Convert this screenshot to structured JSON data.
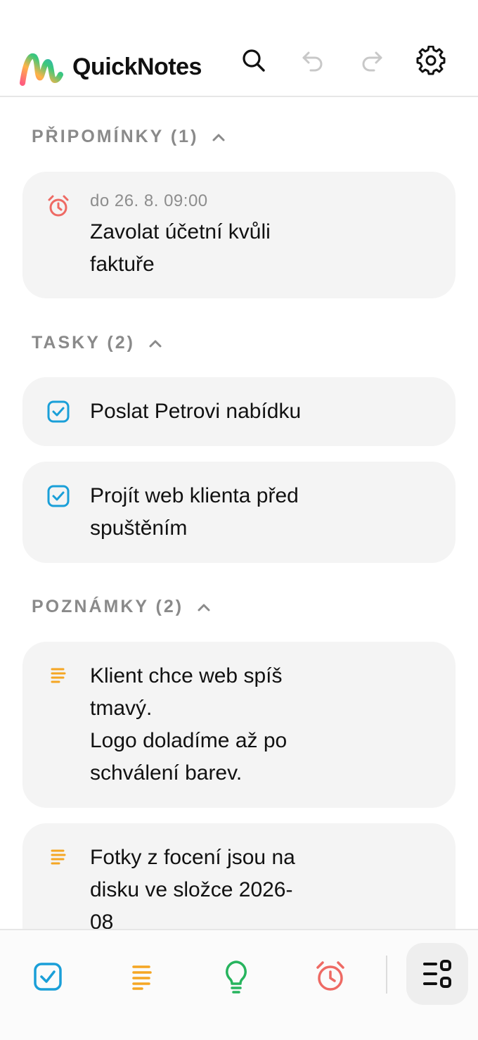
{
  "app": {
    "title": "QuickNotes"
  },
  "header": {
    "icons": {
      "search": "search-icon",
      "undo": "undo-icon",
      "redo": "redo-icon",
      "settings": "gear-icon"
    }
  },
  "sections": {
    "reminders": {
      "title": "PŘIPOMÍNKY (1)",
      "items": [
        {
          "meta": "do 26. 8. 09:00",
          "text": "Zavolat účetní kvůli\nfaktuře",
          "icon": "alarm-clock-icon"
        }
      ]
    },
    "tasks": {
      "title": "TASKY (2)",
      "items": [
        {
          "text": "Poslat Petrovi nabídku",
          "icon": "checkbox-icon"
        },
        {
          "text": "Projít web klienta před\nspuštěním",
          "icon": "checkbox-icon"
        }
      ]
    },
    "notes": {
      "title": "POZNÁMKY (2)",
      "items": [
        {
          "text": "Klient chce web spíš\ntmavý.\nLogo doladíme až po\nschválení barev.",
          "icon": "note-lines-icon"
        },
        {
          "text": "Fotky z focení jsou na\ndisku ve složce 2026-\n08",
          "icon": "note-lines-icon"
        }
      ]
    }
  },
  "bottom_bar": {
    "buttons": [
      "task-checkbox-icon",
      "note-lines-icon",
      "idea-bulb-icon",
      "alarm-clock-icon",
      "menu-grid-icon"
    ]
  },
  "colors": {
    "task_blue": "#1a9fd8",
    "note_orange": "#f5a623",
    "idea_green": "#27b45e",
    "alarm_red": "#ee6a64",
    "section_gray": "#8a8a8a",
    "card_bg": "#f4f4f4"
  }
}
